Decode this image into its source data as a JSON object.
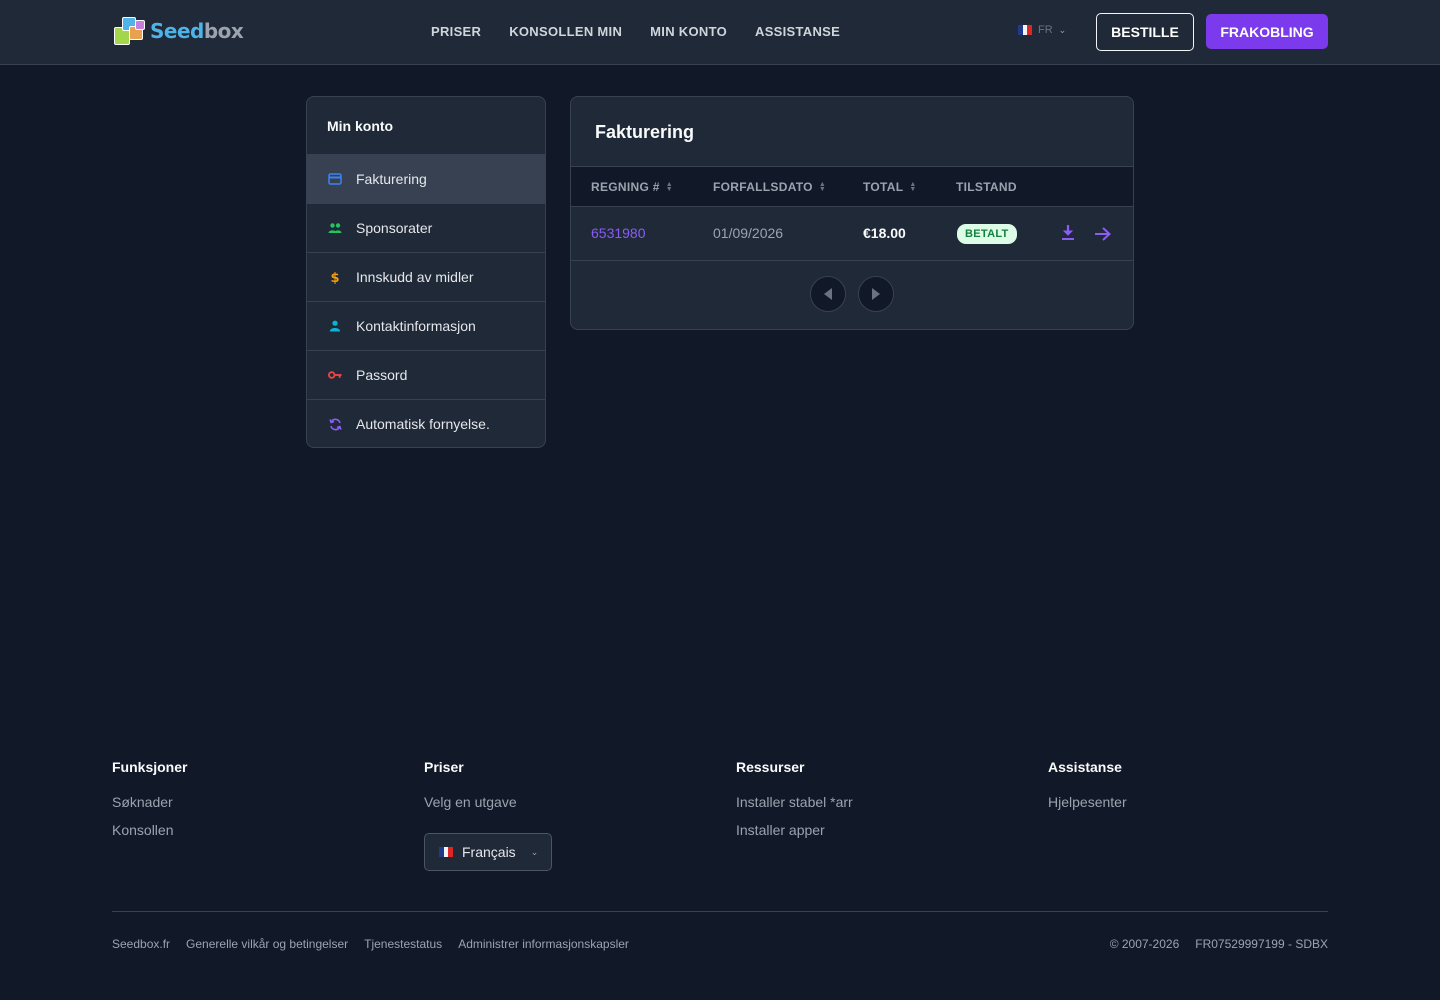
{
  "header": {
    "logo_text_a": "Seed",
    "logo_text_b": "box",
    "nav": [
      "PRISER",
      "KONSOLLEN MIN",
      "MIN KONTO",
      "ASSISTANSE"
    ],
    "lang_code": "FR",
    "order_label": "BESTILLE",
    "logout_label": "FRAKOBLING"
  },
  "sidebar": {
    "title": "Min konto",
    "items": [
      {
        "label": "Fakturering",
        "icon": "credit-card-icon",
        "color": "#3b82f6",
        "active": true
      },
      {
        "label": "Sponsorater",
        "icon": "users-icon",
        "color": "#22c55e"
      },
      {
        "label": "Innskudd av midler",
        "icon": "dollar-icon",
        "color": "#f59e0b"
      },
      {
        "label": "Kontaktinformasjon",
        "icon": "user-icon",
        "color": "#06b6d4"
      },
      {
        "label": "Passord",
        "icon": "key-icon",
        "color": "#ef4444"
      },
      {
        "label": "Automatisk fornyelse.",
        "icon": "refresh-icon",
        "color": "#8b5cf6"
      }
    ]
  },
  "billing": {
    "title": "Fakturering",
    "columns": [
      "REGNING #",
      "FORFALLSDATO",
      "TOTAL",
      "TILSTAND"
    ],
    "rows": [
      {
        "invoice": "6531980",
        "due": "01/09/2026",
        "total": "€18.00",
        "status": "BETALT"
      }
    ]
  },
  "footer": {
    "cols": [
      {
        "title": "Funksjoner",
        "links": [
          "Søknader",
          "Konsollen"
        ]
      },
      {
        "title": "Priser",
        "links": [
          "Velg en utgave"
        ]
      },
      {
        "title": "Ressurser",
        "links": [
          "Installer stabel *arr",
          "Installer apper"
        ]
      },
      {
        "title": "Assistanse",
        "links": [
          "Hjelpesenter"
        ]
      }
    ],
    "language": "Français",
    "bottom_links": [
      "Seedbox.fr",
      "Generelle vilkår og betingelser",
      "Tjenestestatus",
      "Administrer informasjonskapsler"
    ],
    "copyright": "© 2007-2026",
    "company_id": "FR07529997199 - SDBX"
  },
  "colors": {
    "accent": "#7c3aed",
    "paid_bg": "#dcfce7",
    "paid_text": "#15803d"
  }
}
